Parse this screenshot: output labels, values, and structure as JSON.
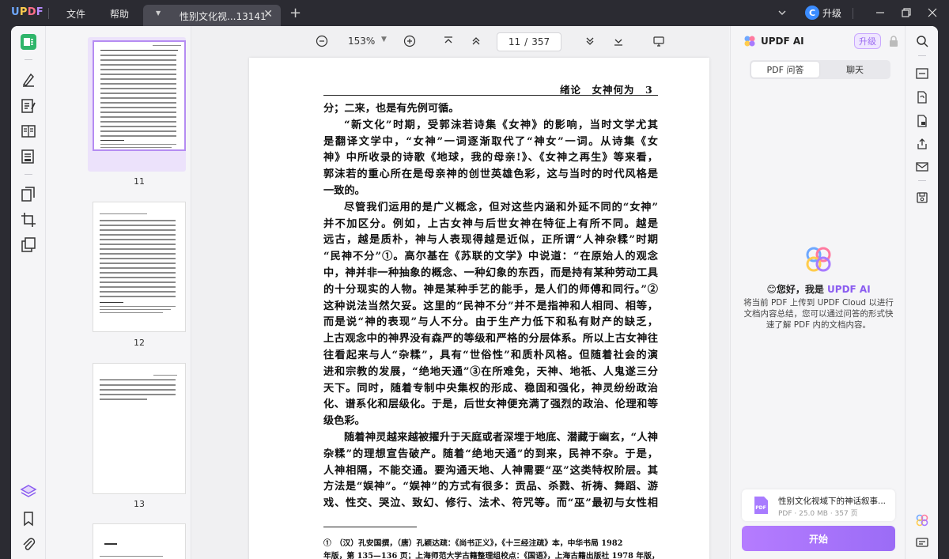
{
  "app": {
    "logo": {
      "u": "U",
      "p": "P",
      "d": "D",
      "f": "F"
    },
    "menu": {
      "file": "文件",
      "help": "帮助"
    },
    "tab": {
      "title": "性别文化视...13141"
    },
    "upgrade": {
      "badge": "C",
      "label": "升级"
    }
  },
  "toolbar": {
    "zoom": "153%",
    "page_current": "11",
    "page_separator": "/",
    "page_total": "357"
  },
  "thumbnails": [
    {
      "label": "11",
      "active": true
    },
    {
      "label": "12",
      "active": false
    },
    {
      "label": "13",
      "active": false
    }
  ],
  "page": {
    "running_head": "绪论　女神何为　3",
    "paragraphs": [
      {
        "indent": false,
        "lines": [
          "分；二来，也是有先例可循。"
        ]
      },
      {
        "indent": true,
        "lines": [
          "“新文化”时期，受郭沫若诗集《女神》的影响，当时文学尤其",
          "是翻译文学中，“女神”一词逐渐取代了“神女”一词。从诗集《女",
          "神》中所收录的诗歌《地球，我的母亲!》、《女神之再生》等来看，",
          "郭沫若的重心所在是母亲神的创世英雄色彩，这与当时的时代风格是",
          "一致的。"
        ]
      },
      {
        "indent": true,
        "lines": [
          "尽管我们运用的是广义概念，但对这些内涵和外延不同的“女神”",
          "并不加区分。例如，上古女神与后世女神在特征上有所不同。越是",
          "远古，越是质朴，神与人表现得越是近似，正所谓“人神杂糅”时期",
          "“民神不分”①。高尔基在《苏联的文学》中说道：“在原始人的观念",
          "中，神并非一种抽象的概念、一种幻象的东西，而是持有某种劳动工具",
          "的十分现实的人物。神是某种手艺的能手，是人们的师傅和同行。”②",
          "这种说法当然欠妥。这里的“民神不分”并不是指神和人相同、相等，",
          "而是说“神的表现”与人不分。由于生产力低下和私有财产的缺乏，",
          "上古观念中的神界没有森严的等级和严格的分层体系。所以上古女神往",
          "往看起来与人“杂糅”，具有“世俗性”和质朴风格。但随着社会的演",
          "进和宗教的发展，“绝地天通”③在所难免，天神、地祇、人鬼遂三分",
          "天下。同时，随着专制中央集权的形成、稳固和强化，神灵纷纷政治",
          "化、谱系化和层级化。于是，后世女神便充满了强烈的政治、伦理和等",
          "级色彩。"
        ]
      },
      {
        "indent": true,
        "lines": [
          "随着神灵越来越被擢升于天庭或者深埋于地底、潜藏于幽玄，“人神",
          "杂糅”的理想宣告破产。随着“绝地天通”的到来，民神不杂。于是，",
          "人神相隔，不能交通。要沟通天地、人神需要“巫”这类特权阶层。其",
          "方法是“娱神”。“娱神”的方式有很多：贡品、杀戮、祈祷、舞蹈、游",
          "戏、性交、哭泣、致幻、修行、法术、符咒等。而“巫”最初与女性相"
        ]
      }
    ],
    "footnotes": [
      "①　（汉）孔安国撰，（唐）孔颖达疏：《尚书正义》，《十三经注疏》本，中华书局 1982",
      "年版，第 135—136 页；上海师范大学古籍整理组校点：《国语》，上海古籍出版社 1978 年版，"
    ]
  },
  "ai_panel": {
    "title": "UPDF AI",
    "upgrade": "升级",
    "tabs": {
      "qa": "PDF 问答",
      "chat": "聊天"
    },
    "hello_prefix": "😊您好，我是 ",
    "hello_brand": "UPDF AI",
    "description": "将当前 PDF 上传到 UPDF Cloud 以进行文档内容总结，您可以通过问答的形式快速了解 PDF 内的文档内容。",
    "file_name": "性别文化视域下的神话叙事...",
    "file_meta": "PDF · 25.0 MB · 357 页",
    "file_badge": "PDF",
    "start": "开始"
  },
  "colors": {
    "accent": "#9b6cf6",
    "titlebar": "#2b2b32",
    "panel": "#f5f5f7"
  }
}
